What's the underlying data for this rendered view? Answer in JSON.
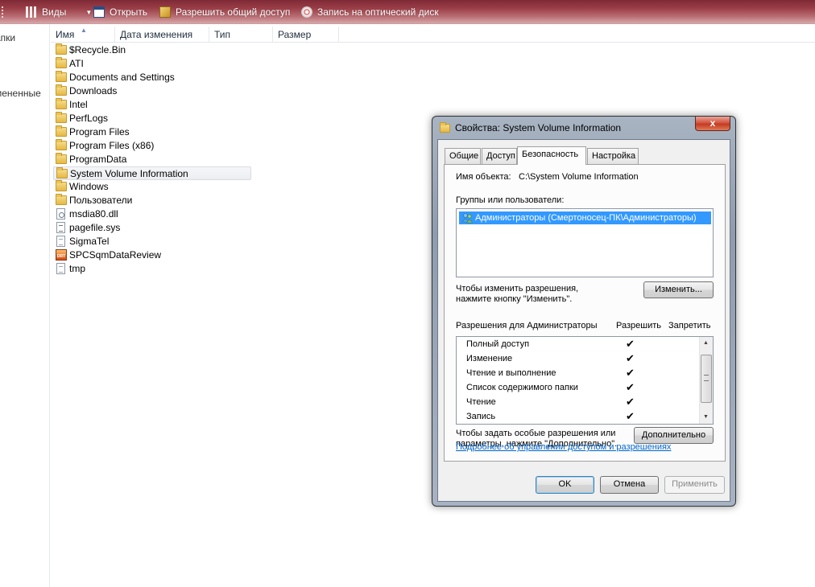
{
  "toolbar": {
    "views": "Виды",
    "open": "Открыть",
    "share": "Разрешить общий доступ",
    "burn": "Запись на оптический диск"
  },
  "nav": {
    "item1": "апки",
    "item2": "мененные"
  },
  "columns": {
    "name": "Имя",
    "date": "Дата изменения",
    "type": "Тип",
    "size": "Размер"
  },
  "files": [
    {
      "name": "$Recycle.Bin",
      "kind": "folder"
    },
    {
      "name": "ATI",
      "kind": "folder"
    },
    {
      "name": "Documents and Settings",
      "kind": "folder"
    },
    {
      "name": "Downloads",
      "kind": "folder"
    },
    {
      "name": "Intel",
      "kind": "folder"
    },
    {
      "name": "PerfLogs",
      "kind": "folder"
    },
    {
      "name": "Program Files",
      "kind": "folder"
    },
    {
      "name": "Program Files (x86)",
      "kind": "folder"
    },
    {
      "name": "ProgramData",
      "kind": "folder"
    },
    {
      "name": "System Volume Information",
      "kind": "folder",
      "selected": true
    },
    {
      "name": "Windows",
      "kind": "folder"
    },
    {
      "name": "Пользователи",
      "kind": "folder"
    },
    {
      "name": "msdia80.dll",
      "kind": "dll"
    },
    {
      "name": "pagefile.sys",
      "kind": "sys"
    },
    {
      "name": "SigmaTel",
      "kind": "txt"
    },
    {
      "name": "SPCSqmDataReview",
      "kind": "app",
      "badge": "DRT"
    },
    {
      "name": "tmp",
      "kind": "txt"
    }
  ],
  "dialog": {
    "title": "Свойства: System Volume Information",
    "close": "x",
    "tabs": [
      "Общие",
      "Доступ",
      "Безопасность",
      "Настройка"
    ],
    "object_label": "Имя объекта:",
    "object_value": "C:\\System Volume Information",
    "groups_label": "Группы или пользователи:",
    "group_item": "Администраторы (Смертоносец-ПК\\Администраторы)",
    "change_hint_1": "Чтобы изменить разрешения,",
    "change_hint_2": "нажмите кнопку \"Изменить\".",
    "change_button": "Изменить...",
    "perm_label": "Разрешения для Администраторы",
    "allow": "Разрешить",
    "deny": "Запретить",
    "check": "✔",
    "permissions": [
      {
        "name": "Полный доступ",
        "allow": true
      },
      {
        "name": "Изменение",
        "allow": true
      },
      {
        "name": "Чтение и выполнение",
        "allow": true
      },
      {
        "name": "Список содержимого папки",
        "allow": true
      },
      {
        "name": "Чтение",
        "allow": true
      },
      {
        "name": "Запись",
        "allow": true
      }
    ],
    "special_hint_1": "Чтобы задать особые разрешения или",
    "special_hint_2": "параметры, нажмите \"Дополнительно\".",
    "advanced_button": "Дополнительно",
    "link": "Подробнее об управлении доступом и разрешениях",
    "ok": "OK",
    "cancel": "Отмена",
    "apply": "Применить"
  }
}
